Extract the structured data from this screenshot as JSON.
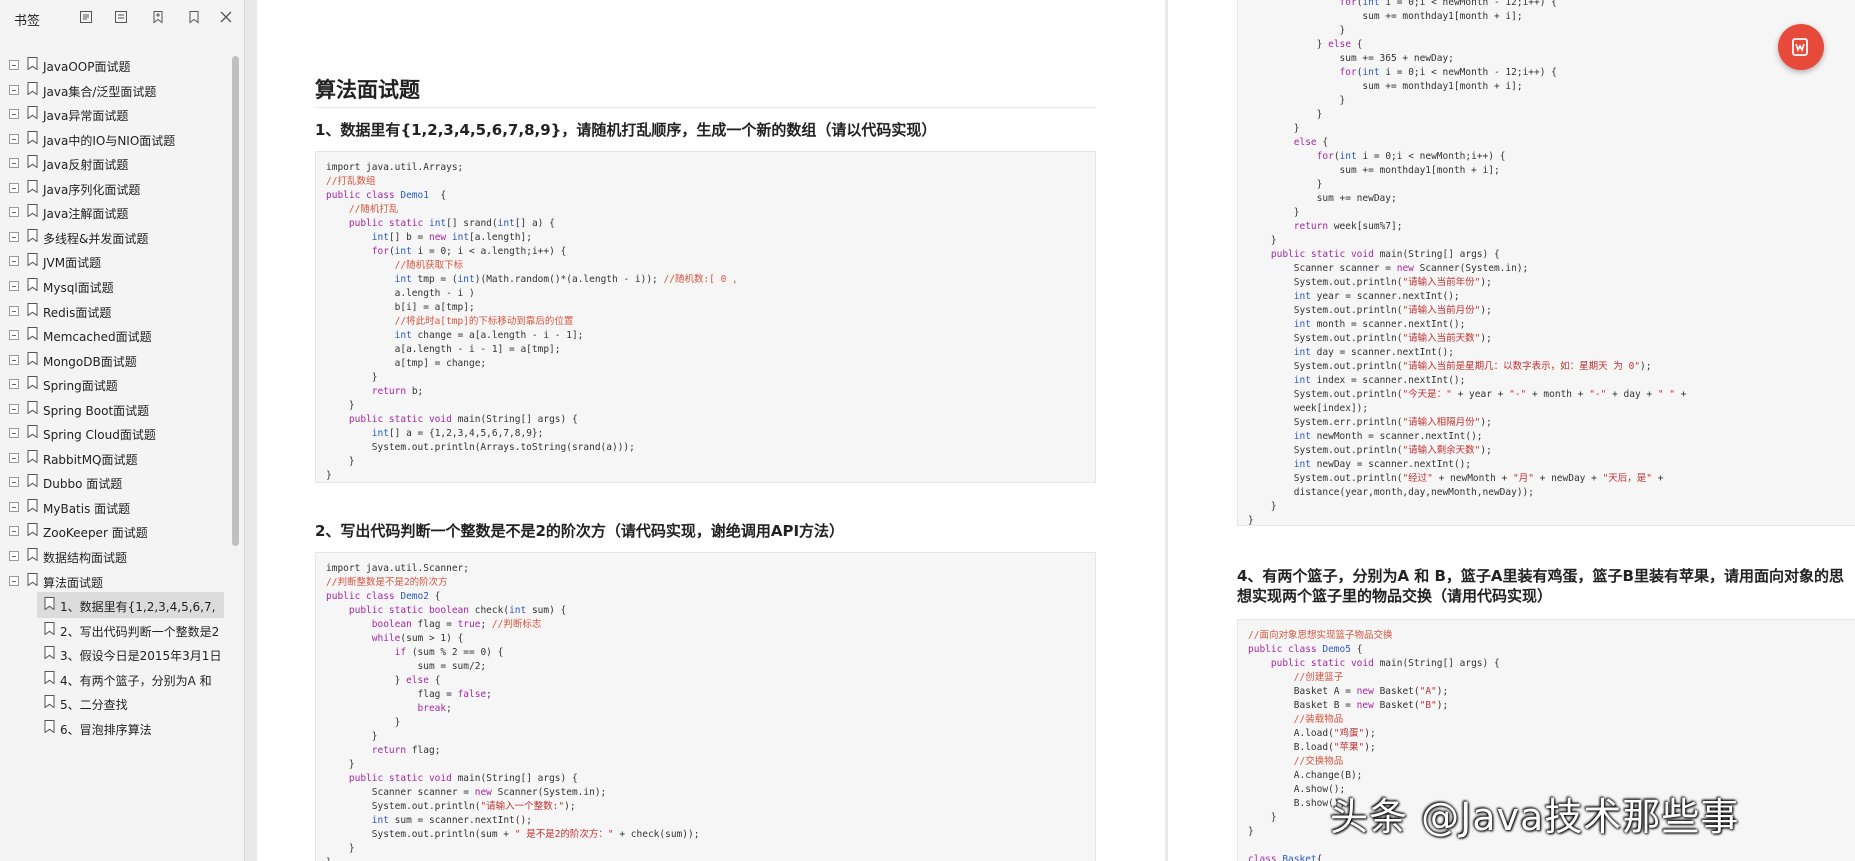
{
  "sidebar": {
    "title": "书签",
    "toolbar": [
      "expand-all-icon",
      "collapse-all-icon",
      "add-bookmark-icon",
      "bookmark-icon",
      "close-icon"
    ],
    "items": [
      {
        "label": "JavaOOP面试题",
        "level": 0
      },
      {
        "label": "Java集合/泛型面试题",
        "level": 0
      },
      {
        "label": "Java异常面试题",
        "level": 0
      },
      {
        "label": "Java中的IO与NIO面试题",
        "level": 0
      },
      {
        "label": "Java反射面试题",
        "level": 0
      },
      {
        "label": "Java序列化面试题",
        "level": 0
      },
      {
        "label": "Java注解面试题",
        "level": 0
      },
      {
        "label": "多线程&并发面试题",
        "level": 0
      },
      {
        "label": "JVM面试题",
        "level": 0
      },
      {
        "label": "Mysql面试题",
        "level": 0
      },
      {
        "label": "Redis面试题",
        "level": 0
      },
      {
        "label": "Memcached面试题",
        "level": 0
      },
      {
        "label": "MongoDB面试题",
        "level": 0
      },
      {
        "label": "Spring面试题",
        "level": 0
      },
      {
        "label": "Spring Boot面试题",
        "level": 0
      },
      {
        "label": "Spring Cloud面试题",
        "level": 0
      },
      {
        "label": "RabbitMQ面试题",
        "level": 0
      },
      {
        "label": "Dubbo 面试题",
        "level": 0
      },
      {
        "label": "MyBatis 面试题",
        "level": 0
      },
      {
        "label": "ZooKeeper 面试题",
        "level": 0
      },
      {
        "label": "数据结构面试题",
        "level": 0
      },
      {
        "label": "算法面试题",
        "level": 0
      },
      {
        "label": "1、数据里有{1,2,3,4,5,6,7,",
        "level": 1,
        "selected": true
      },
      {
        "label": "2、写出代码判断一个整数是2",
        "level": 1
      },
      {
        "label": "3、假设今日是2015年3月1日:",
        "level": 1
      },
      {
        "label": "4、有两个篮子，分别为A 和",
        "level": 1
      },
      {
        "label": "5、二分查找",
        "level": 1
      },
      {
        "label": "6、冒泡排序算法",
        "level": 1
      }
    ]
  },
  "page1": {
    "section_title": "算法面试题",
    "q1_title": "1、数据里有{1,2,3,4,5,6,7,8,9}，请随机打乱顺序，生成一个新的数组（请以代码实现）",
    "q2_title": "2、写出代码判断一个整数是不是2的阶次方（请代码实现，谢绝调用API方法）",
    "code1": [
      [
        [
          "",
          "import java.util.Arrays;"
        ]
      ],
      [
        [
          "cm",
          "//打乱数组"
        ]
      ],
      [
        [
          "kw",
          "public class "
        ],
        [
          "nm",
          "Demo1"
        ],
        [
          "",
          "  {"
        ]
      ],
      [
        [
          "",
          "    "
        ],
        [
          "cm",
          "//随机打乱"
        ]
      ],
      [
        [
          "",
          "    "
        ],
        [
          "kw",
          "public static "
        ],
        [
          "ty",
          "int"
        ],
        [
          "",
          "[] srand("
        ],
        [
          "ty",
          "int"
        ],
        [
          "",
          "[] a) {"
        ]
      ],
      [
        [
          "",
          "        "
        ],
        [
          "ty",
          "int"
        ],
        [
          "",
          "[] b = "
        ],
        [
          "kw",
          "new "
        ],
        [
          "ty",
          "int"
        ],
        [
          "",
          "[a.length];"
        ]
      ],
      [
        [
          "",
          "        "
        ],
        [
          "kw",
          "for"
        ],
        [
          "",
          "("
        ],
        [
          "ty",
          "int"
        ],
        [
          "",
          " i = 0; i < a.length;i++) {"
        ]
      ],
      [
        [
          "",
          "            "
        ],
        [
          "cm",
          "//随机获取下标"
        ]
      ],
      [
        [
          "",
          "            "
        ],
        [
          "ty",
          "int"
        ],
        [
          "",
          " tmp = ("
        ],
        [
          "ty",
          "int"
        ],
        [
          "",
          ")(Math.random()*(a.length - i)); "
        ],
        [
          "cm",
          "//随机数:[ 0 ,"
        ]
      ],
      [
        [
          "",
          "            a.length - i )"
        ]
      ],
      [
        [
          "",
          "            b[i] = a[tmp];"
        ]
      ],
      [
        [
          "",
          "            "
        ],
        [
          "cm",
          "//将此时a[tmp]的下标移动到靠后的位置"
        ]
      ],
      [
        [
          "",
          "            "
        ],
        [
          "ty",
          "int"
        ],
        [
          "",
          " change = a[a.length - i - 1];"
        ]
      ],
      [
        [
          "",
          "            a[a.length - i - 1] = a[tmp];"
        ]
      ],
      [
        [
          "",
          "            a[tmp] = change;"
        ]
      ],
      [
        [
          "",
          "        }"
        ]
      ],
      [
        [
          "",
          "        "
        ],
        [
          "kw",
          "return"
        ],
        [
          "",
          " b;"
        ]
      ],
      [
        [
          "",
          "    }"
        ]
      ],
      [
        [
          "",
          "    "
        ],
        [
          "kw",
          "public static void "
        ],
        [
          "",
          "main(String[] args) {"
        ]
      ],
      [
        [
          "",
          "        "
        ],
        [
          "ty",
          "int"
        ],
        [
          "",
          "[] a = {1,2,3,4,5,6,7,8,9};"
        ]
      ],
      [
        [
          "",
          "        System.out.println(Arrays.toString(srand(a)));"
        ]
      ],
      [
        [
          "",
          "    }"
        ]
      ],
      [
        [
          "",
          "}"
        ]
      ]
    ],
    "code2": [
      [
        [
          "",
          "import java.util.Scanner;"
        ]
      ],
      [
        [
          "cm",
          "//判断整数是不是2的阶次方"
        ]
      ],
      [
        [
          "kw",
          "public class "
        ],
        [
          "nm",
          "Demo2"
        ],
        [
          "",
          " {"
        ]
      ],
      [
        [
          "",
          "    "
        ],
        [
          "kw",
          "public static boolean "
        ],
        [
          "",
          "check("
        ],
        [
          "ty",
          "int"
        ],
        [
          "",
          " sum) {"
        ]
      ],
      [
        [
          "",
          "        "
        ],
        [
          "kw",
          "boolean"
        ],
        [
          "",
          " flag = "
        ],
        [
          "kw",
          "true"
        ],
        [
          "",
          "; "
        ],
        [
          "cm",
          "//判断标志"
        ]
      ],
      [
        [
          "",
          "        "
        ],
        [
          "kw",
          "while"
        ],
        [
          "",
          "(sum > 1) {"
        ]
      ],
      [
        [
          "",
          "            "
        ],
        [
          "kw",
          "if"
        ],
        [
          "",
          " (sum % 2 == 0) {"
        ]
      ],
      [
        [
          "",
          "                sum = sum/2;"
        ]
      ],
      [
        [
          "",
          "            } "
        ],
        [
          "kw",
          "else"
        ],
        [
          "",
          " {"
        ]
      ],
      [
        [
          "",
          "                flag = "
        ],
        [
          "kw",
          "false"
        ],
        [
          "",
          ";"
        ]
      ],
      [
        [
          "",
          "                "
        ],
        [
          "kw",
          "break"
        ],
        [
          "",
          ";"
        ]
      ],
      [
        [
          "",
          "            }"
        ]
      ],
      [
        [
          "",
          "        }"
        ]
      ],
      [
        [
          "",
          "        "
        ],
        [
          "kw",
          "return"
        ],
        [
          "",
          " flag;"
        ]
      ],
      [
        [
          "",
          "    }"
        ]
      ],
      [
        [
          "",
          "    "
        ],
        [
          "kw",
          "public static void "
        ],
        [
          "",
          "main(String[] args) {"
        ]
      ],
      [
        [
          "",
          "        Scanner scanner = "
        ],
        [
          "kw",
          "new"
        ],
        [
          "",
          " Scanner(System.in);"
        ]
      ],
      [
        [
          "",
          "        System.out.println("
        ],
        [
          "st",
          "\"请输入一个整数:\""
        ],
        [
          "",
          ");"
        ]
      ],
      [
        [
          "",
          "        "
        ],
        [
          "ty",
          "int"
        ],
        [
          "",
          " sum = scanner.nextInt();"
        ]
      ],
      [
        [
          "",
          "        System.out.println(sum + "
        ],
        [
          "st",
          "\" 是不是2的阶次方：\""
        ],
        [
          "",
          " + check(sum));"
        ]
      ],
      [
        [
          "",
          "    }"
        ]
      ],
      [
        [
          "",
          "}"
        ]
      ]
    ]
  },
  "page2": {
    "q4_title": "4、有两个篮子，分别为A 和 B，篮子A里装有鸡蛋，篮子B里装有苹果，请用面向对象的思想实现两个篮子里的物品交换（请用代码实现）",
    "code3": [
      [
        [
          "",
          "                "
        ],
        [
          "kw",
          "for"
        ],
        [
          "",
          "("
        ],
        [
          "ty",
          "int"
        ],
        [
          "",
          " i = 0;i < newMonth - 12;i++) {"
        ]
      ],
      [
        [
          "",
          "                    sum += monthday1[month + i];"
        ]
      ],
      [
        [
          "",
          "                }"
        ]
      ],
      [
        [
          "",
          "            } "
        ],
        [
          "kw",
          "else"
        ],
        [
          "",
          " {"
        ]
      ],
      [
        [
          "",
          "                sum += 365 + newDay;"
        ]
      ],
      [
        [
          "",
          "                "
        ],
        [
          "kw",
          "for"
        ],
        [
          "",
          "("
        ],
        [
          "ty",
          "int"
        ],
        [
          "",
          " i = 0;i < newMonth - 12;i++) {"
        ]
      ],
      [
        [
          "",
          "                    sum += monthday1[month + i];"
        ]
      ],
      [
        [
          "",
          "                }"
        ]
      ],
      [
        [
          "",
          "            }"
        ]
      ],
      [
        [
          "",
          "        }"
        ]
      ],
      [
        [
          "",
          "        "
        ],
        [
          "kw",
          "else"
        ],
        [
          "",
          " {"
        ]
      ],
      [
        [
          "",
          "            "
        ],
        [
          "kw",
          "for"
        ],
        [
          "",
          "("
        ],
        [
          "ty",
          "int"
        ],
        [
          "",
          " i = 0;i < newMonth;i++) {"
        ]
      ],
      [
        [
          "",
          "                sum += monthday1[month + i];"
        ]
      ],
      [
        [
          "",
          "            }"
        ]
      ],
      [
        [
          "",
          "            sum += newDay;"
        ]
      ],
      [
        [
          "",
          "        }"
        ]
      ],
      [
        [
          "",
          "        "
        ],
        [
          "kw",
          "return"
        ],
        [
          "",
          " week[sum%7];"
        ]
      ],
      [
        [
          "",
          "    }"
        ]
      ],
      [
        [
          "",
          "    "
        ],
        [
          "kw",
          "public static void "
        ],
        [
          "",
          "main(String[] args) {"
        ]
      ],
      [
        [
          "",
          "        Scanner scanner = "
        ],
        [
          "kw",
          "new"
        ],
        [
          "",
          " Scanner(System.in);"
        ]
      ],
      [
        [
          "",
          "        System.out.println("
        ],
        [
          "st",
          "\"请输入当前年份\""
        ],
        [
          "",
          ");"
        ]
      ],
      [
        [
          "",
          "        "
        ],
        [
          "ty",
          "int"
        ],
        [
          "",
          " year = scanner.nextInt();"
        ]
      ],
      [
        [
          "",
          "        System.out.println("
        ],
        [
          "st",
          "\"请输入当前月份\""
        ],
        [
          "",
          ");"
        ]
      ],
      [
        [
          "",
          "        "
        ],
        [
          "ty",
          "int"
        ],
        [
          "",
          " month = scanner.nextInt();"
        ]
      ],
      [
        [
          "",
          "        System.out.println("
        ],
        [
          "st",
          "\"请输入当前天数\""
        ],
        [
          "",
          ");"
        ]
      ],
      [
        [
          "",
          "        "
        ],
        [
          "ty",
          "int"
        ],
        [
          "",
          " day = scanner.nextInt();"
        ]
      ],
      [
        [
          "",
          "        System.out.println("
        ],
        [
          "st",
          "\"请输入当前是星期几：以数字表示，如：星期天 为 0\""
        ],
        [
          "",
          ");"
        ]
      ],
      [
        [
          "",
          "        "
        ],
        [
          "ty",
          "int"
        ],
        [
          "",
          " index = scanner.nextInt();"
        ]
      ],
      [
        [
          "",
          "        System.out.println("
        ],
        [
          "st",
          "\"今天是：\""
        ],
        [
          "",
          " + year + "
        ],
        [
          "st",
          "\"-\""
        ],
        [
          "",
          " + month + "
        ],
        [
          "st",
          "\"-\""
        ],
        [
          "",
          " + day + "
        ],
        [
          "st",
          "\" \""
        ],
        [
          "",
          " +"
        ]
      ],
      [
        [
          "",
          "        week[index]);"
        ]
      ],
      [
        [
          "",
          "        System.err.println("
        ],
        [
          "st",
          "\"请输入相隔月份\""
        ],
        [
          "",
          ");"
        ]
      ],
      [
        [
          "",
          "        "
        ],
        [
          "ty",
          "int"
        ],
        [
          "",
          " newMonth = scanner.nextInt();"
        ]
      ],
      [
        [
          "",
          "        System.out.println("
        ],
        [
          "st",
          "\"请输入剩余天数\""
        ],
        [
          "",
          ");"
        ]
      ],
      [
        [
          "",
          "        "
        ],
        [
          "ty",
          "int"
        ],
        [
          "",
          " newDay = scanner.nextInt();"
        ]
      ],
      [
        [
          "",
          "        System.out.println("
        ],
        [
          "st",
          "\"经过\""
        ],
        [
          "",
          " + newMonth + "
        ],
        [
          "st",
          "\"月\""
        ],
        [
          "",
          " + newDay + "
        ],
        [
          "st",
          "\"天后，是\""
        ],
        [
          "",
          " +"
        ]
      ],
      [
        [
          "",
          "        distance(year,month,day,newMonth,newDay));"
        ]
      ],
      [
        [
          "",
          "    }"
        ]
      ],
      [
        [
          "",
          "}"
        ]
      ]
    ],
    "code4": [
      [
        [
          "cm",
          "//面向对象思想实现篮子物品交换"
        ]
      ],
      [
        [
          "kw",
          "public class "
        ],
        [
          "nm",
          "Demo5"
        ],
        [
          "",
          " {"
        ]
      ],
      [
        [
          "",
          "    "
        ],
        [
          "kw",
          "public static void "
        ],
        [
          "",
          "main(String[] args) {"
        ]
      ],
      [
        [
          "",
          "        "
        ],
        [
          "cm",
          "//创建篮子"
        ]
      ],
      [
        [
          "",
          "        Basket A = "
        ],
        [
          "kw",
          "new"
        ],
        [
          "",
          " Basket("
        ],
        [
          "st",
          "\"A\""
        ],
        [
          "",
          ");"
        ]
      ],
      [
        [
          "",
          "        Basket B = "
        ],
        [
          "kw",
          "new"
        ],
        [
          "",
          " Basket("
        ],
        [
          "st",
          "\"B\""
        ],
        [
          "",
          ");"
        ]
      ],
      [
        [
          "",
          "        "
        ],
        [
          "cm",
          "//装载物品"
        ]
      ],
      [
        [
          "",
          "        A.load("
        ],
        [
          "st",
          "\"鸡蛋\""
        ],
        [
          "",
          ");"
        ]
      ],
      [
        [
          "",
          "        B.load("
        ],
        [
          "st",
          "\"苹果\""
        ],
        [
          "",
          ");"
        ]
      ],
      [
        [
          "",
          "        "
        ],
        [
          "cm",
          "//交换物品"
        ]
      ],
      [
        [
          "",
          "        A.change(B);"
        ]
      ],
      [
        [
          "",
          "        A.show();"
        ]
      ],
      [
        [
          "",
          "        B.show();"
        ]
      ],
      [
        [
          "",
          "    }"
        ]
      ],
      [
        [
          "",
          "}"
        ]
      ],
      [
        [
          "",
          ""
        ]
      ],
      [
        [
          "kw",
          "class "
        ],
        [
          "nm",
          "Basket"
        ],
        [
          "",
          "{"
        ]
      ]
    ]
  },
  "watermark": "头条 @Java技术那些事",
  "colors": {
    "accent": "#e74a3b",
    "keyword": "#a626a4",
    "comment": "#d4553f",
    "string": "#c03030",
    "type": "#2b59c3"
  }
}
